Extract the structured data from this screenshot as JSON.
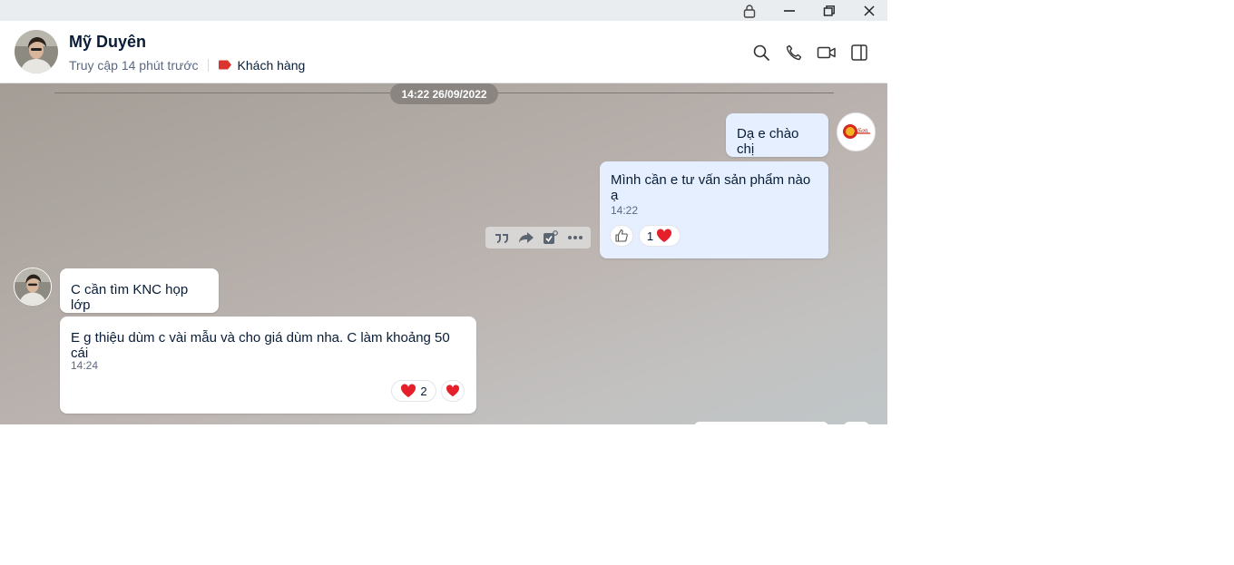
{
  "window": {
    "controls": [
      "lock-icon",
      "minimize-icon",
      "restore-icon",
      "close-icon"
    ]
  },
  "header": {
    "name": "Mỹ Duyên",
    "status": "Truy cập 14 phút trước",
    "tag_label": "Khách hàng",
    "tag_color": "#db342e",
    "actions": [
      "search-icon",
      "phone-icon",
      "video-icon",
      "sidebar-toggle-icon"
    ]
  },
  "chat": {
    "date_divider": "14:22 26/09/2022",
    "messages": [
      {
        "from": "me",
        "text": "Dạ e chào chị"
      },
      {
        "from": "me",
        "text": "Mình cần e tư vấn sản phẩm nào ạ",
        "time": "14:22",
        "reaction_count": "1",
        "reaction": "heart-icon"
      },
      {
        "from": "them",
        "text": "C cần tìm KNC họp lớp"
      },
      {
        "from": "them",
        "text": "E g thiệu dùm c vài mẫu và cho giá dùm nha. C làm khoảng 50 cái",
        "time": "14:24",
        "reaction_count": "2",
        "reaction": "heart-icon"
      }
    ],
    "hover_toolbar": [
      "quote-icon",
      "forward-icon",
      "todo-icon",
      "more-icon"
    ]
  },
  "colors": {
    "accent": "#0068ff",
    "my_bubble": "#e5efff",
    "their_bubble": "#ffffff",
    "heart": "#e5202b"
  }
}
